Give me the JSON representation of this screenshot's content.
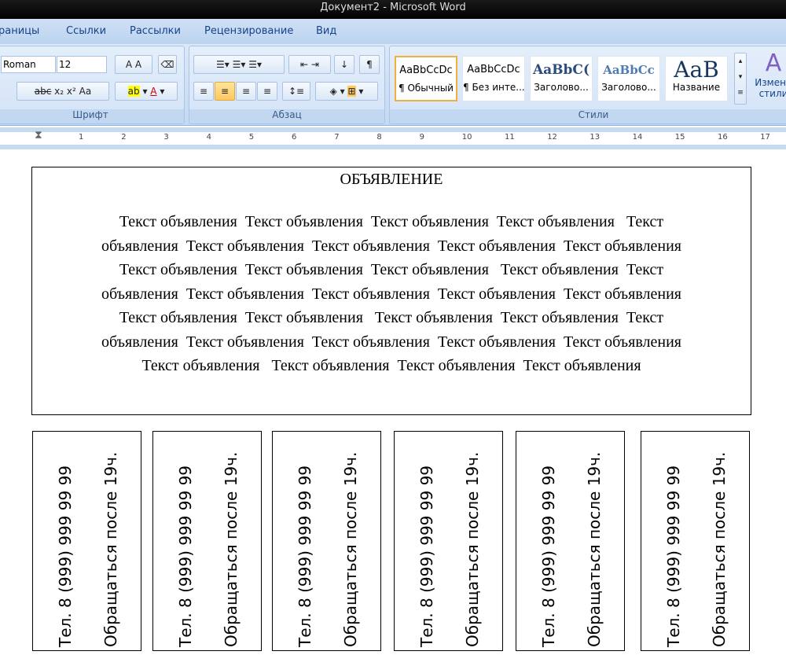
{
  "window": {
    "title": "Документ2 - Microsoft Word"
  },
  "tabs": [
    "раницы",
    "Ссылки",
    "Рассылки",
    "Рецензирование",
    "Вид"
  ],
  "font": {
    "name": "Roman",
    "size": "12",
    "group": "Шрифт"
  },
  "paragraph": {
    "group": "Абзац"
  },
  "styles": {
    "group": "Стили",
    "items": [
      {
        "sample": "AaBbCcDc",
        "label": "¶ Обычный"
      },
      {
        "sample": "AaBbCcDc",
        "label": "¶ Без инте..."
      },
      {
        "sample": "AaBbC(",
        "label": "Заголово..."
      },
      {
        "sample": "AaBbCc",
        "label": "Заголово..."
      },
      {
        "sample": "AaB",
        "label": "Название"
      }
    ],
    "change": "Измени стили"
  },
  "ruler": [
    "1",
    "2",
    "3",
    "4",
    "5",
    "6",
    "7",
    "8",
    "9",
    "10",
    "11",
    "12",
    "13",
    "14",
    "15",
    "16",
    "17"
  ],
  "document": {
    "heading": "ОБЪЯВЛЕНИЕ",
    "lines": [
      "Текст объявления  Текст объявления  Текст объявления  Текст объявления   Текст",
      "объявления  Текст объявления  Текст объявления  Текст объявления  Текст объявления",
      "Текст объявления  Текст объявления  Текст объявления   Текст объявления  Текст",
      "объявления  Текст объявления  Текст объявления  Текст объявления  Текст объявления",
      "Текст объявления  Текст объявления   Текст объявления  Текст объявления  Текст",
      "объявления  Текст объявления  Текст объявления  Текст объявления  Текст объявления",
      "Текст объявления   Текст объявления  Текст объявления  Текст объявления"
    ],
    "strip": {
      "phone": "Тел. 8 (999) 999 99 99",
      "note": "Обращаться после 19ч."
    }
  }
}
